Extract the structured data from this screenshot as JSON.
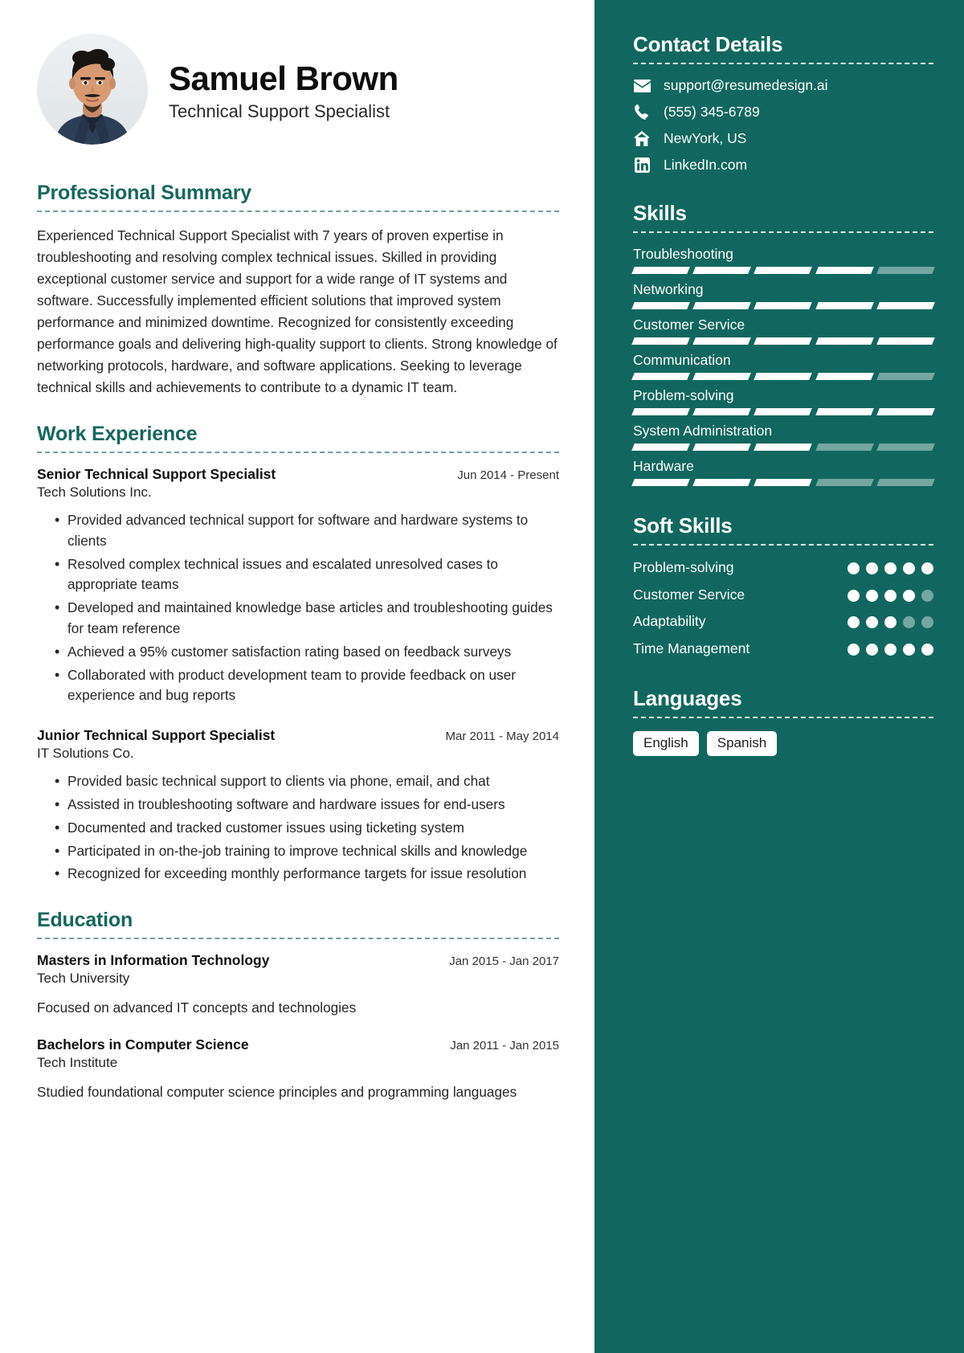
{
  "profile": {
    "name": "Samuel Brown",
    "job_title": "Technical Support Specialist",
    "avatar_alt": "profile-photo"
  },
  "accent_color": "#17675f",
  "sidebar_bg": "#11675f",
  "sections": {
    "summary_title": "Professional Summary",
    "experience_title": "Work Experience",
    "education_title": "Education"
  },
  "summary": {
    "text": "Experienced Technical Support Specialist with 7 years of proven expertise in troubleshooting and resolving complex technical issues. Skilled in providing exceptional customer service and support for a wide range of IT systems and software. Successfully implemented efficient solutions that improved system performance and minimized downtime. Recognized for consistently exceeding performance goals and delivering high-quality support to clients. Strong knowledge of networking protocols, hardware, and software applications. Seeking to leverage technical skills and achievements to contribute to a dynamic IT team."
  },
  "experience": [
    {
      "role": "Senior Technical Support Specialist",
      "date": "Jun 2014 - Present",
      "org": "Tech Solutions Inc.",
      "bullets": [
        "Provided advanced technical support for software and hardware systems to clients",
        "Resolved complex technical issues and escalated unresolved cases to appropriate teams",
        "Developed and maintained knowledge base articles and troubleshooting guides for team reference",
        "Achieved a 95% customer satisfaction rating based on feedback surveys",
        "Collaborated with product development team to provide feedback on user experience and bug reports"
      ]
    },
    {
      "role": "Junior Technical Support Specialist",
      "date": "Mar 2011 - May 2014",
      "org": "IT Solutions Co.",
      "bullets": [
        "Provided basic technical support to clients via phone, email, and chat",
        "Assisted in troubleshooting software and hardware issues for end-users",
        "Documented and tracked customer issues using ticketing system",
        "Participated in on-the-job training to improve technical skills and knowledge",
        "Recognized for exceeding monthly performance targets for issue resolution"
      ]
    }
  ],
  "education": [
    {
      "degree": "Masters in Information Technology",
      "date": "Jan 2015 - Jan 2017",
      "school": "Tech University",
      "description": "Focused on advanced IT concepts and technologies"
    },
    {
      "degree": "Bachelors in Computer Science",
      "date": "Jan 2011 - Jan 2015",
      "school": "Tech Institute",
      "description": "Studied foundational computer science principles and programming languages"
    }
  ],
  "contact": {
    "title": "Contact Details",
    "items": [
      {
        "icon": "envelope-icon",
        "value": "support@resumedesign.ai"
      },
      {
        "icon": "phone-icon",
        "value": "(555) 345-6789"
      },
      {
        "icon": "home-icon",
        "value": "NewYork, US"
      },
      {
        "icon": "linkedin-icon",
        "value": "LinkedIn.com"
      }
    ]
  },
  "skills": {
    "title": "Skills",
    "max": 5,
    "items": [
      {
        "label": "Troubleshooting",
        "level": 4
      },
      {
        "label": "Networking",
        "level": 5
      },
      {
        "label": "Customer Service",
        "level": 5
      },
      {
        "label": "Communication",
        "level": 4
      },
      {
        "label": "Problem-solving",
        "level": 5
      },
      {
        "label": "System Administration",
        "level": 3
      },
      {
        "label": "Hardware",
        "level": 3
      }
    ]
  },
  "soft_skills": {
    "title": "Soft Skills",
    "max": 5,
    "items": [
      {
        "label": "Problem-solving",
        "level": 5
      },
      {
        "label": "Customer Service",
        "level": 4
      },
      {
        "label": "Adaptability",
        "level": 3
      },
      {
        "label": "Time Management",
        "level": 5
      }
    ]
  },
  "languages": {
    "title": "Languages",
    "items": [
      "English",
      "Spanish"
    ]
  }
}
